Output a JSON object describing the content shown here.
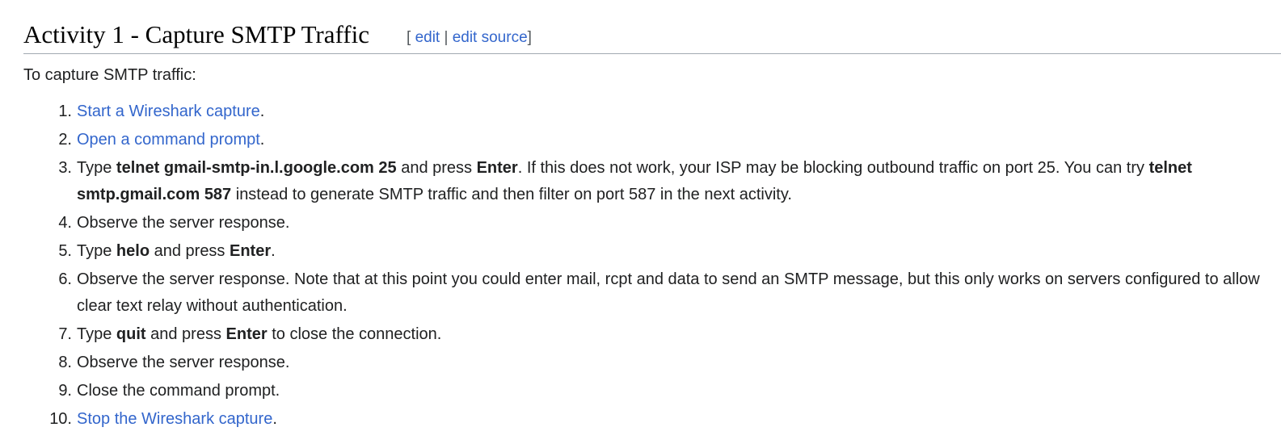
{
  "section": {
    "title": "Activity 1 - Capture SMTP Traffic",
    "edit_open": "[",
    "edit_label": "edit",
    "edit_divider": "|",
    "edit_source_label": "edit source",
    "edit_close": "]"
  },
  "intro": "To capture SMTP traffic:",
  "steps": [
    {
      "number": "1.",
      "link": "Start a Wireshark capture",
      "end": "."
    },
    {
      "number": "2.",
      "link": "Open a command prompt",
      "end": "."
    },
    {
      "number": "3.",
      "t1": "Type ",
      "b1": "telnet gmail-smtp-in.l.google.com 25",
      "t2": " and press ",
      "b2": "Enter",
      "t3": ". If this does not work, your ISP may be blocking outbound traffic on port 25. You can try ",
      "b3": "telnet smtp.gmail.com 587",
      "t4": " instead to generate SMTP traffic and then filter on port 587 in the next activity."
    },
    {
      "number": "4.",
      "text": "Observe the server response."
    },
    {
      "number": "5.",
      "t1": "Type ",
      "b1": "helo",
      "t2": " and press ",
      "b2": "Enter",
      "t3": "."
    },
    {
      "number": "6.",
      "text": "Observe the server response. Note that at this point you could enter mail, rcpt and data to send an SMTP message, but this only works on servers configured to allow clear text relay without authentication."
    },
    {
      "number": "7.",
      "t1": "Type ",
      "b1": "quit",
      "t2": " and press ",
      "b2": "Enter",
      "t3": " to close the connection."
    },
    {
      "number": "8.",
      "text": "Observe the server response."
    },
    {
      "number": "9.",
      "text": "Close the command prompt."
    },
    {
      "number": "10.",
      "link": "Stop the Wireshark capture",
      "end": "."
    }
  ],
  "colors": {
    "link": "#3366cc",
    "text": "#202122",
    "heading": "#000000",
    "rule": "#a2a9b1",
    "muted": "#54595d"
  }
}
